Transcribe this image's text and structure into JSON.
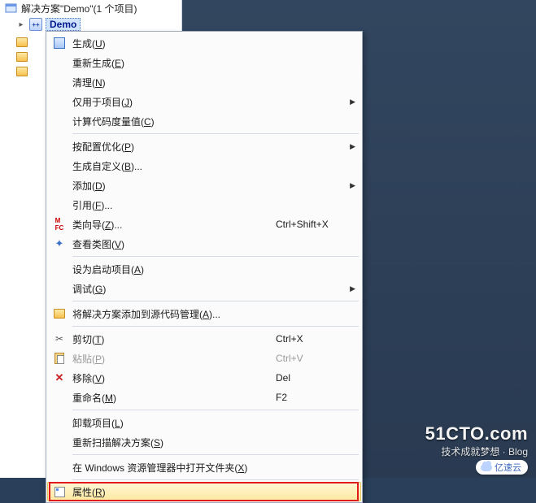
{
  "explorer": {
    "solution_label": "解决方案\"Demo\"(1 个项目)",
    "project_label": "Demo"
  },
  "menu": {
    "build": {
      "pre": "生成(",
      "acc": "U",
      "post": ")"
    },
    "rebuild": {
      "pre": "重新生成(",
      "acc": "E",
      "post": ")"
    },
    "clean": {
      "pre": "清理(",
      "acc": "N",
      "post": ")"
    },
    "proj_only": {
      "pre": "仅用于项目(",
      "acc": "J",
      "post": ")"
    },
    "metrics": {
      "pre": "计算代码度量值(",
      "acc": "C",
      "post": ")"
    },
    "pgo": {
      "pre": "按配置优化(",
      "acc": "P",
      "post": ")"
    },
    "build_custom": {
      "pre": "生成自定义(",
      "acc": "B",
      "post": ")..."
    },
    "add": {
      "pre": "添加(",
      "acc": "D",
      "post": ")"
    },
    "refs": {
      "pre": "引用(",
      "acc": "F",
      "post": ")..."
    },
    "class_wiz": {
      "pre": "类向导(",
      "acc": "Z",
      "post": ")...",
      "shortcut": "Ctrl+Shift+X"
    },
    "class_view": {
      "pre": "查看类图(",
      "acc": "V",
      "post": ")"
    },
    "set_startup": {
      "pre": "设为启动项目(",
      "acc": "A",
      "post": ")"
    },
    "debug": {
      "pre": "调试(",
      "acc": "G",
      "post": ")"
    },
    "add_scc": {
      "pre": "将解决方案添加到源代码管理(",
      "acc": "A",
      "post": ")..."
    },
    "cut": {
      "pre": "剪切(",
      "acc": "T",
      "post": ")",
      "shortcut": "Ctrl+X"
    },
    "paste": {
      "pre": "粘贴(",
      "acc": "P",
      "post": ")",
      "shortcut": "Ctrl+V"
    },
    "remove": {
      "pre": "移除(",
      "acc": "V",
      "post": ")",
      "shortcut": "Del"
    },
    "rename": {
      "pre": "重命名(",
      "acc": "M",
      "post": ")",
      "shortcut": "F2"
    },
    "unload": {
      "pre": "卸载项目(",
      "acc": "L",
      "post": ")"
    },
    "rescan": {
      "pre": "重新扫描解决方案(",
      "acc": "S",
      "post": ")"
    },
    "open_folder": {
      "pre": "在 Windows 资源管理器中打开文件夹(",
      "acc": "X",
      "post": ")"
    },
    "properties": {
      "pre": "属性(",
      "acc": "R",
      "post": ")"
    }
  },
  "watermark": {
    "big": "51CTO.com",
    "small": "技术成就梦想 · Blog",
    "badge": "亿速云"
  }
}
